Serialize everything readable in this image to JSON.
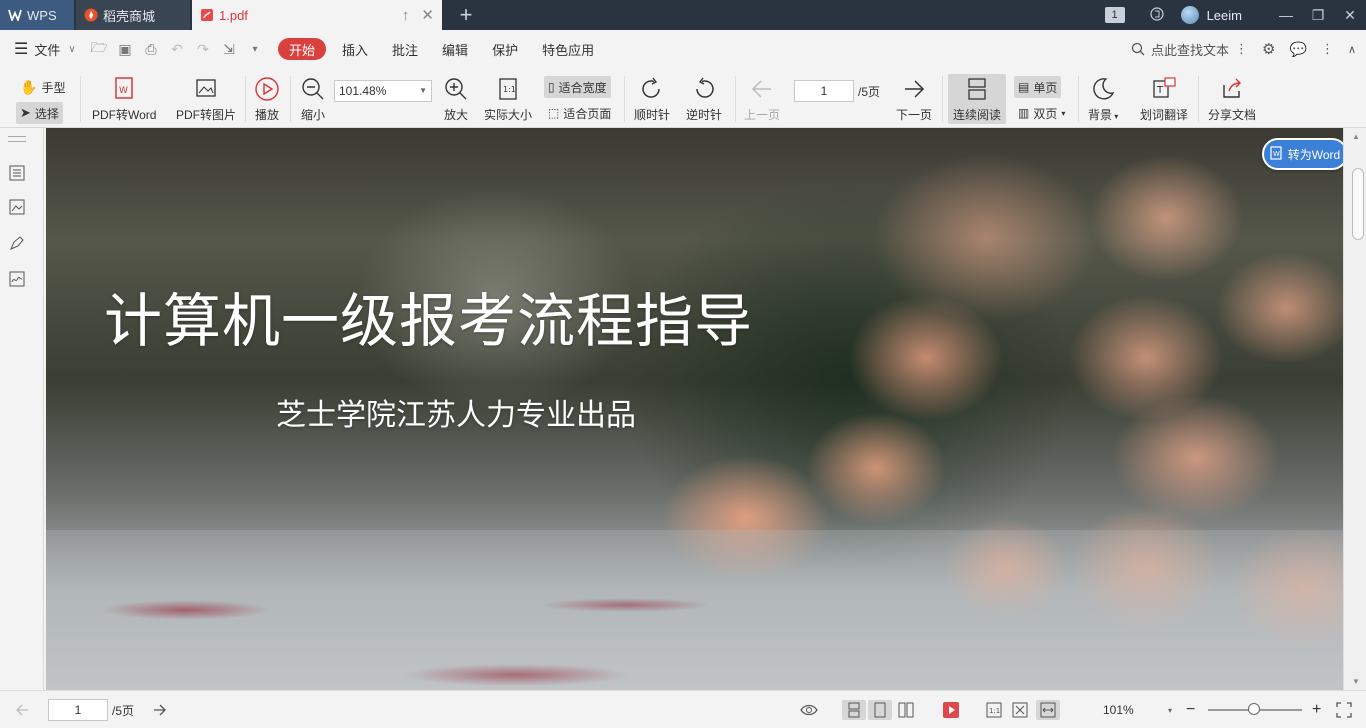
{
  "titlebar": {
    "tabs": [
      {
        "label": "WPS"
      },
      {
        "label": "稻壳商城"
      },
      {
        "label": "1.pdf"
      }
    ],
    "window_count": "1",
    "user": "Leeim"
  },
  "menubar": {
    "file": "文件",
    "items": [
      "开始",
      "插入",
      "批注",
      "编辑",
      "保护",
      "特色应用"
    ],
    "active": "开始",
    "search": "点此查找文本"
  },
  "ribbon": {
    "hand": "手型",
    "select": "选择",
    "pdf_to_word": "PDF转Word",
    "pdf_to_image": "PDF转图片",
    "play": "播放",
    "zoom_out": "缩小",
    "zoom_value": "101.48%",
    "zoom_in": "放大",
    "actual_size": "实际大小",
    "fit_width": "适合宽度",
    "fit_page": "适合页面",
    "rotate_cw": "顺时针",
    "rotate_ccw": "逆时针",
    "prev_page": "上一页",
    "page_current": "1",
    "page_total": "/5页",
    "next_page": "下一页",
    "continuous": "连续阅读",
    "single_page": "单页",
    "double_page": "双页",
    "background": "背景",
    "translate": "划词翻译",
    "share": "分享文档"
  },
  "document": {
    "title": "计算机一级报考流程指导",
    "subtitle": "芝士学院江苏人力专业出品",
    "to_word": "转为Word"
  },
  "statusbar": {
    "page_current": "1",
    "page_total": "/5页",
    "zoom": "101%"
  },
  "colors": {
    "titlebar_bg": "#2a3441",
    "accent_red": "#d9413e",
    "to_word_blue": "#3b7fd6"
  }
}
